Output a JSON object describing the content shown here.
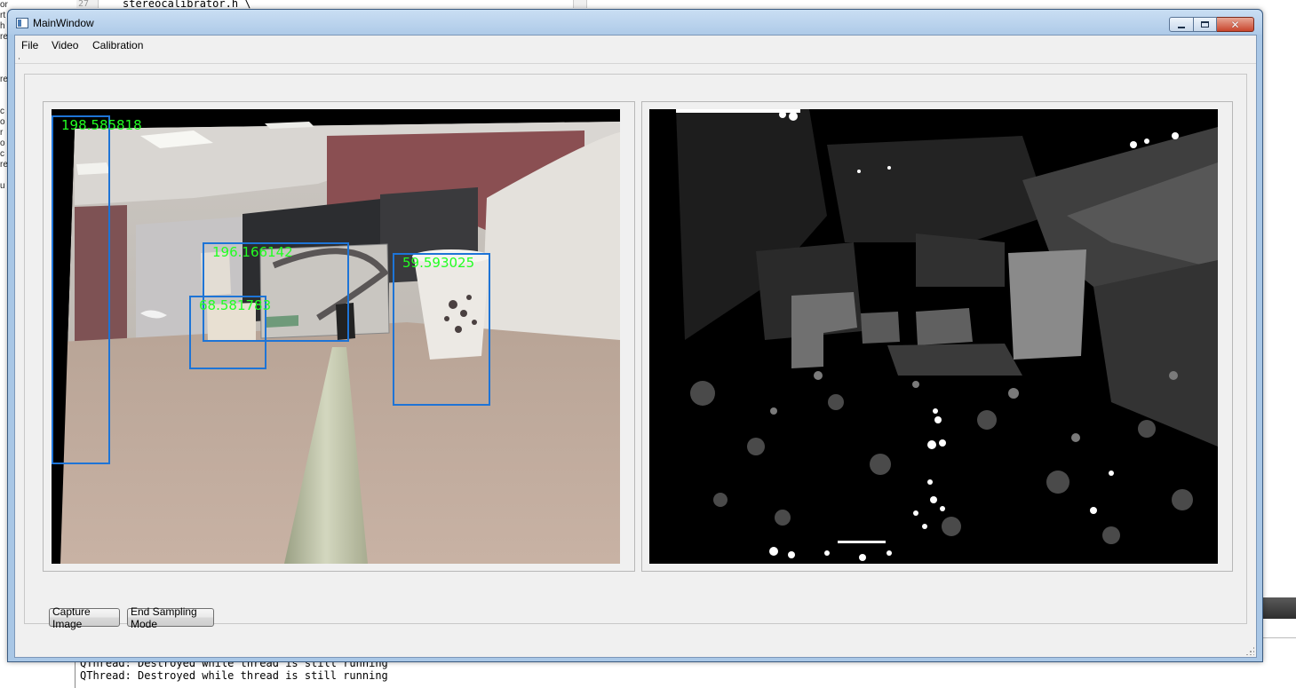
{
  "background": {
    "left_text": [
      "or",
      "rt",
      "h",
      "re",
      "",
      "",
      "",
      "re",
      "",
      "",
      "c",
      "o",
      "r",
      "o",
      "c",
      "re",
      "",
      "u"
    ],
    "line_number": "27",
    "code_top": "stereocalibrator.h \\",
    "console_lines": [
      "QThread: Destroyed while thread is still running",
      "QThread: Destroyed while thread is still running"
    ]
  },
  "window": {
    "title": "MainWindow",
    "close_glyph": "✕"
  },
  "menu": {
    "file": "File",
    "video": "Video",
    "calibration": "Calibration"
  },
  "detections": [
    {
      "label": "198.585818"
    },
    {
      "label": "196.166142"
    },
    {
      "label": "68.581783"
    },
    {
      "label": "59.593025"
    }
  ],
  "buttons": {
    "capture": "Capture Image",
    "end_sampling": "End Sampling Mode"
  },
  "colors": {
    "box": "#1e74d6",
    "label": "#22ff22",
    "titlebar": "#aecae8",
    "client": "#f0f0f0"
  }
}
